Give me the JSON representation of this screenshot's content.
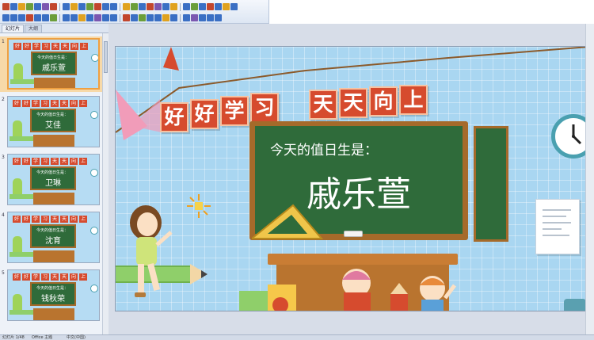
{
  "toolbar": {
    "row1_colors": [
      "#c2462d",
      "#3a6fc4",
      "#e0a21f",
      "#6b9e3a",
      "#3a6fc4",
      "#7b57b0",
      "#c2462d",
      "#3a6fc4",
      "#e0a21f",
      "#3a6fc4",
      "#6b9e3a",
      "#c2462d",
      "#3a6fc4",
      "#3a6fc4",
      "#e0a21f",
      "#6b9e3a",
      "#3a6fc4",
      "#c2462d",
      "#7b57b0",
      "#3a6fc4",
      "#e0a21f",
      "#3a6fc4",
      "#6b9e3a",
      "#3a6fc4",
      "#c2462d",
      "#3a6fc4",
      "#e0a21f",
      "#3a6fc4"
    ],
    "row2_colors": [
      "#3a6fc4",
      "#3a6fc4",
      "#3a6fc4",
      "#c2462d",
      "#3a6fc4",
      "#3a6fc4",
      "#6b9e3a",
      "#3a6fc4",
      "#3a6fc4",
      "#e0a21f",
      "#3a6fc4",
      "#7b57b0",
      "#3a6fc4",
      "#3a6fc4",
      "#c2462d",
      "#3a6fc4",
      "#6b9e3a",
      "#3a6fc4",
      "#3a6fc4",
      "#e0a21f",
      "#3a6fc4",
      "#3a6fc4",
      "#7b57b0",
      "#3a6fc4",
      "#3a6fc4",
      "#3a6fc4"
    ]
  },
  "panel": {
    "tabs": [
      {
        "label": "幻灯片",
        "active": true
      },
      {
        "label": "大纲",
        "active": false
      }
    ],
    "slides": [
      {
        "number": "1",
        "subtitle": "今天的值日生是：",
        "name": "戚乐萱",
        "selected": true
      },
      {
        "number": "2",
        "subtitle": "今天的值日生是：",
        "name": "艾佳",
        "selected": false
      },
      {
        "number": "3",
        "subtitle": "今天的值日生是：",
        "name": "卫琳",
        "selected": false
      },
      {
        "number": "4",
        "subtitle": "今天的值日生是：",
        "name": "沈育",
        "selected": false
      },
      {
        "number": "5",
        "subtitle": "今天的值日生是：",
        "name": "钱秋荣",
        "selected": false
      }
    ],
    "thumb_banner": [
      "好",
      "好",
      "学",
      "习",
      "天",
      "天",
      "向",
      "上"
    ]
  },
  "slide": {
    "banner_chars": [
      "好",
      "好",
      "学",
      "习",
      "天",
      "天",
      "向",
      "上"
    ],
    "board_subtitle": "今天的值日生是：",
    "board_name": "戚乐萱",
    "colors": {
      "background": "#a9d6f1",
      "banner": "#d64b2e",
      "board": "#2f6b3a",
      "frame": "#a56a2a",
      "desk": "#b9742f",
      "clock_rim": "#4aa0b0"
    }
  },
  "status": {
    "slide_info": "幻灯片 1/48",
    "theme": "Office 主题",
    "language": "中文(中国)"
  }
}
